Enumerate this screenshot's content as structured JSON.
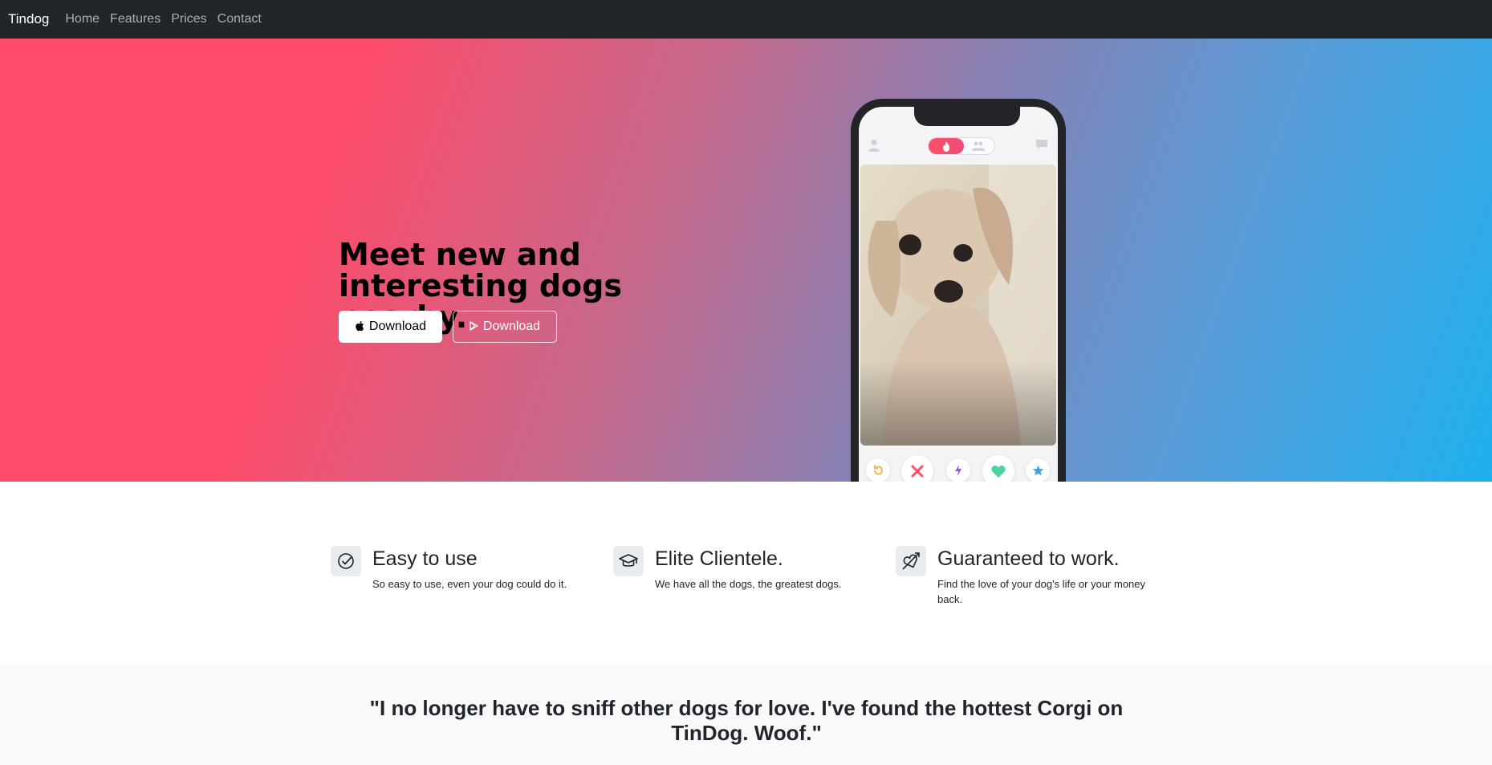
{
  "navbar": {
    "brand": "Tindog",
    "links": [
      "Home",
      "Features",
      "Prices",
      "Contact"
    ]
  },
  "hero": {
    "title": "Meet new and interesting dogs nearby.",
    "buttons": [
      {
        "label": "Download",
        "icon": "apple-icon"
      },
      {
        "label": "Download",
        "icon": "google-play-icon"
      }
    ]
  },
  "phone": {
    "top_icons": [
      "user-icon",
      "flame-icon",
      "people-icon",
      "chat-icon"
    ],
    "actions": [
      "rewind-icon",
      "nope-icon",
      "boost-icon",
      "like-icon",
      "super-like-icon"
    ],
    "colors": {
      "rewind": "#f5b748",
      "nope": "#fd5068",
      "boost": "#915dd1",
      "like": "#1be4a1",
      "super_like": "#2db2ff"
    }
  },
  "features": [
    {
      "icon": "check-circle-icon",
      "title": "Easy to use",
      "text": "So easy to use, even your dog could do it."
    },
    {
      "icon": "mortarboard-icon",
      "title": "Elite Clientele.",
      "text": "We have all the dogs, the greatest dogs."
    },
    {
      "icon": "arrow-through-heart-icon",
      "title": "Guaranteed to work.",
      "text": "Find the love of your dog's life or your money back."
    }
  ],
  "testimonial": {
    "quote": "\"I no longer have to sniff other dogs for love. I've found the hottest Corgi on TinDog. Woof.\""
  },
  "colors": {
    "navbar": "#212529",
    "gradient_start": "#ff4b69",
    "gradient_end": "#1fb1ee",
    "testimonial_bg": "#f8f9fa"
  }
}
